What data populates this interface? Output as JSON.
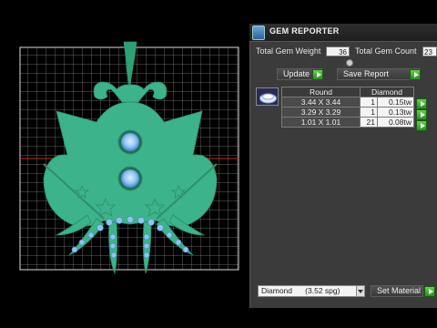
{
  "panel": {
    "title": "GEM REPORTER",
    "icon": "gem-reporter-app-icon"
  },
  "summary": {
    "weight_label": "Total Gem Weight",
    "weight_value": "36",
    "count_label": "Total Gem Count",
    "count_value": "23"
  },
  "actions": {
    "update_label": "Update",
    "save_report_label": "Save Report",
    "set_material_label": "Set Material"
  },
  "table": {
    "header_shape": "Round",
    "header_material": "Diamond",
    "rows": [
      {
        "size": "3.44 X 3.44",
        "count": "1",
        "weight": "0.15tw"
      },
      {
        "size": "3.29 X 3.29",
        "count": "1",
        "weight": "0.13tw"
      },
      {
        "size": "1.01 X 1.01",
        "count": "21",
        "weight": "0.08tw"
      }
    ]
  },
  "material": {
    "selected": "Diamond      (3.52 spg)"
  },
  "colors": {
    "jewelry": "#3cb38a",
    "gem": "#7fb8f0",
    "grid": "#cfcfcf",
    "panel_bg": "#3b3b3b",
    "go_button": "#3fb52e"
  },
  "icons": [
    "go-arrow-icon",
    "dropdown-arrow-icon",
    "round-gem-icon"
  ]
}
